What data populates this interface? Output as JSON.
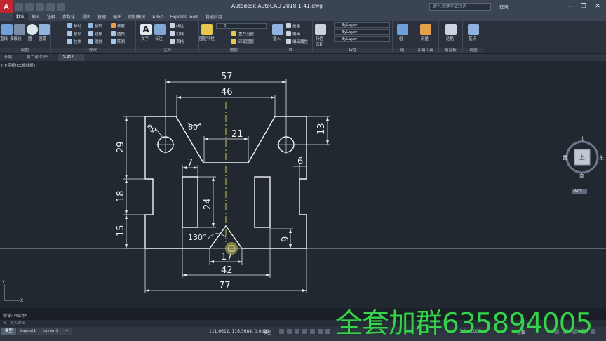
{
  "titlebar": {
    "logo": "A",
    "title": "Autodesk AutoCAD 2018    1-41.dwg",
    "search_placeholder": "键入关键字或短语",
    "signin": "登录",
    "minimize": "—",
    "restore": "❐",
    "close": "✕"
  },
  "ribbon_tabs": [
    "默认",
    "插入",
    "注释",
    "参数化",
    "视图",
    "管理",
    "输出",
    "附加模块",
    "A360",
    "Express Tools",
    "精选应用"
  ],
  "ribbon": {
    "draw_group": "绘图",
    "draw_tools": [
      "直线",
      "多段线",
      "圆",
      "圆弧"
    ],
    "modify_group": "修改",
    "modify_tools": [
      "移动",
      "旋转",
      "修剪",
      "复制",
      "镜像",
      "圆角",
      "拉伸",
      "缩放",
      "阵列"
    ],
    "annotation_group": "注释",
    "annotation_tools": [
      "文字",
      "标注",
      "线性",
      "引线",
      "表格"
    ],
    "layers_group": "图层",
    "layer_tools": [
      "图层特性",
      "置为当前",
      "匹配图层"
    ],
    "layer_combo": "0",
    "block_group": "块",
    "block_tools": [
      "插入",
      "创建",
      "编辑",
      "编辑属性"
    ],
    "properties_group": "特性",
    "properties_tools": [
      "特性",
      "匹配"
    ],
    "bylayer": [
      "ByLayer",
      "ByLayer",
      "ByLayer"
    ],
    "groups_group": "组",
    "groups_tool": "组",
    "utilities_group": "实用工具",
    "utilities_tool": "测量",
    "clipboard_group": "剪贴板",
    "clipboard_tool": "粘贴",
    "view_group": "视图",
    "view_tool": "基点"
  },
  "file_tabs": [
    "开始",
    "第二课作业*",
    "1-41*"
  ],
  "viewport_label": "[-][俯视][二维线框]",
  "dimensions": {
    "d57": "57",
    "d46": "46",
    "d21": "21",
    "d60": "60°",
    "d9": "⌀9",
    "d13": "13",
    "d29": "29",
    "d7": "7",
    "d6": "6",
    "d24": "24",
    "d18": "18",
    "d15": "15",
    "d130": "130°",
    "d9b": "9",
    "d17": "17",
    "d42": "42",
    "d77": "77"
  },
  "viewcube": {
    "north": "北",
    "south": "南",
    "east": "东",
    "west": "西",
    "top": "上",
    "wcs": "WCS"
  },
  "command": {
    "history": "命令: *取消*",
    "input_placeholder": "键入命令",
    "close": "✕"
  },
  "status": {
    "layouts": [
      "模型",
      "Layout1",
      "Layout2"
    ],
    "add_layout": "+",
    "coords": "111.6612, 116.3684, 0.0000",
    "model": "模型",
    "scale": "1:1 / 100%",
    "small": "小数"
  },
  "watermark": "全套加群635894005"
}
